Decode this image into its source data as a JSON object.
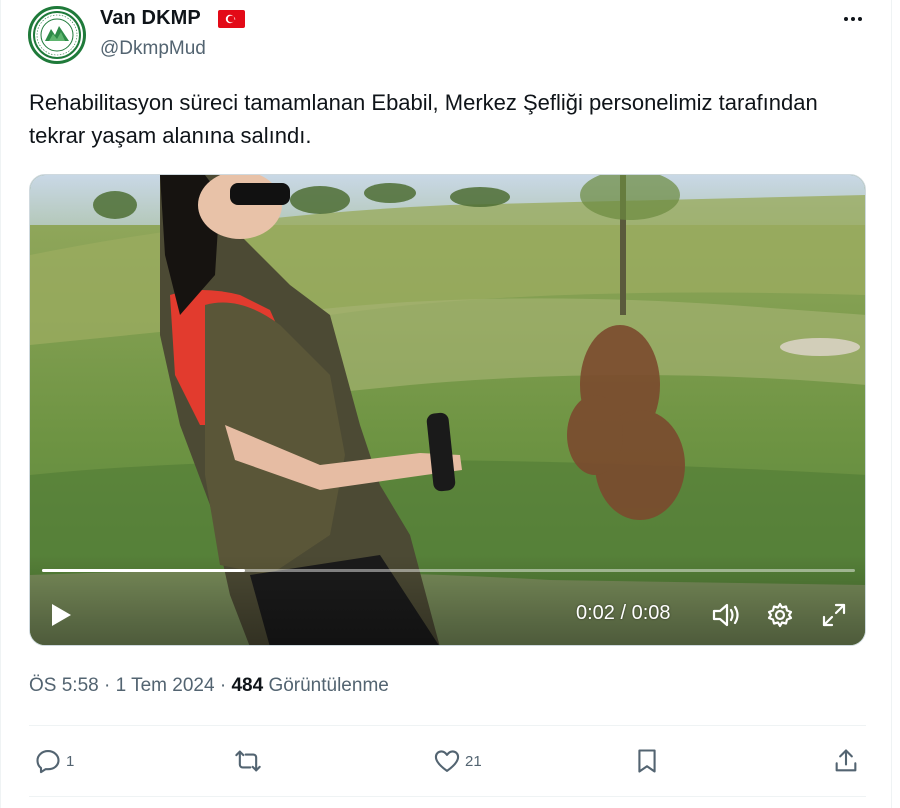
{
  "author": {
    "name": "Van DKMP",
    "handle": "@DkmpMud",
    "avatar_icon": "dkmp-emblem-icon",
    "flag_icon": "turkey-flag-icon"
  },
  "more_icon": "ellipsis-icon",
  "tweet": {
    "text": "Rehabilitasyon süreci tamamlanan Ebabil, Merkez Şefliği personelimiz tarafından tekrar yaşam alanına salındı."
  },
  "video": {
    "current_time": "0:02",
    "duration": "0:08",
    "time_display": "0:02 / 0:08",
    "progress_fraction": 0.25,
    "icons": [
      "play-icon",
      "volume-icon",
      "settings-gear-icon",
      "fullscreen-icon"
    ]
  },
  "meta": {
    "time": "ÖS 5:58",
    "separator": "·",
    "date": "1 Tem 2024",
    "views": "484",
    "views_label": "Görüntülenme"
  },
  "actions": {
    "reply_count": "1",
    "retweet_count": "",
    "like_count": "21",
    "icons": [
      "reply-icon",
      "retweet-icon",
      "like-icon",
      "bookmark-icon",
      "share-icon"
    ]
  },
  "colors": {
    "text": "#0f1419",
    "secondary": "#536471",
    "border": "#eff3f4",
    "flag_red": "#e30a17"
  }
}
